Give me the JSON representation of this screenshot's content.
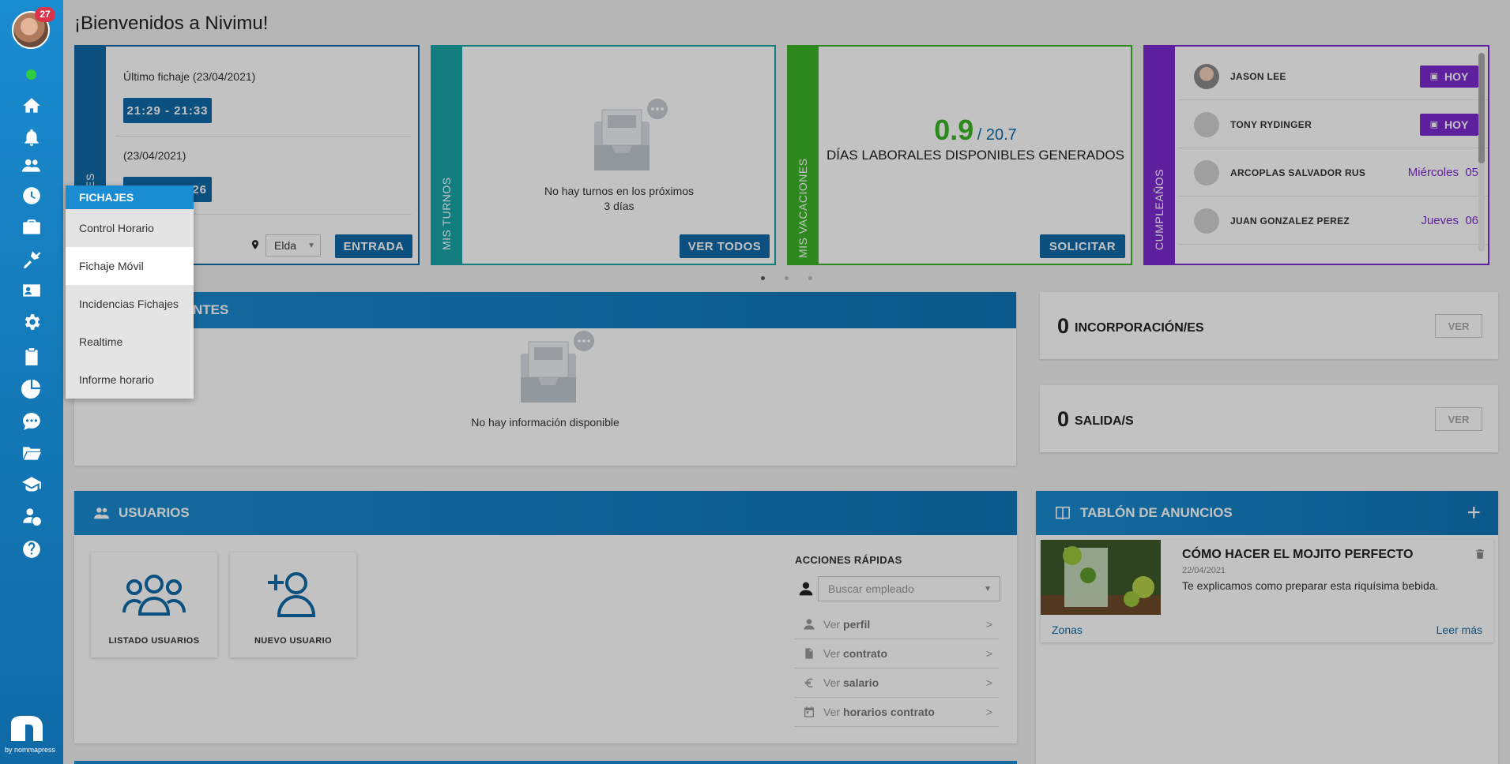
{
  "header": {
    "title": "¡Bienvenidos a Nivimu!"
  },
  "sidebar": {
    "badge": "27",
    "logo_text": "by nommapress",
    "icons": [
      "home-icon",
      "bell-icon",
      "users-icon",
      "clock-icon",
      "briefcase-icon",
      "tools-icon",
      "id-card-icon",
      "gear-icon",
      "clipboard-icon",
      "pie-chart-icon",
      "chat-icon",
      "folder-icon",
      "graduation-icon",
      "user-dollar-icon",
      "help-icon"
    ]
  },
  "fichajes_card": {
    "vertical_label": "ES",
    "last_label": "Último fichaje (23/04/2021)",
    "last_time": "21:29 - 21:33",
    "second_label": "(23/04/2021)",
    "second_time_suffix": "26",
    "location": "Elda",
    "button": "ENTRADA"
  },
  "turnos_card": {
    "vertical_label": "MIS TURNOS",
    "empty_line1": "No hay turnos en los próximos",
    "empty_line2": "3 días",
    "button": "VER TODOS"
  },
  "vacaciones_card": {
    "vertical_label": "MIS VACACIONES",
    "value": "0.9",
    "total": "/ 20.7",
    "caption": "DÍAS LABORALES DISPONIBLES GENERADOS",
    "button": "SOLICITAR"
  },
  "cumple_card": {
    "vertical_label": "CUMPLEAÑOS",
    "people": [
      {
        "name": "JASON LEE",
        "tag": "HOY"
      },
      {
        "name": "TONY RYDINGER",
        "tag": "HOY"
      },
      {
        "name": "ARCOPLAS SALVADOR RUS",
        "day": "Miércoles",
        "num": "05"
      },
      {
        "name": "JUAN GONZALEZ PEREZ",
        "day": "Jueves",
        "num": "06"
      }
    ]
  },
  "pendientes": {
    "title": "NTES",
    "empty": "No hay información disponible"
  },
  "incorporaciones": {
    "count": "0",
    "label": "INCORPORACIÓN/ES",
    "button": "VER"
  },
  "salidas": {
    "count": "0",
    "label": "SALIDA/S",
    "button": "VER"
  },
  "usuarios": {
    "title": "USUARIOS",
    "tile1": "LISTADO USUARIOS",
    "tile2": "NUEVO USUARIO",
    "quick_title": "ACCIONES RÁPIDAS",
    "search_placeholder": "Buscar empleado",
    "actions": [
      {
        "prefix": "Ver",
        "bold": "perfil"
      },
      {
        "prefix": "Ver",
        "bold": "contrato"
      },
      {
        "prefix": "Ver",
        "bold": "salario"
      },
      {
        "prefix": "Ver",
        "bold": "horarios contrato"
      }
    ]
  },
  "anuncios": {
    "title": "TABLÓN DE ANUNCIOS",
    "post_title": "CÓMO HACER EL MOJITO PERFECTO",
    "post_date": "22/04/2021",
    "post_text": "Te explicamos como preparar esta riquísima bebida.",
    "post_tag": "Zonas",
    "read_more": "Leer más"
  },
  "dropdown": {
    "title": "FICHAJES",
    "items": [
      "Control Horario",
      "Fichaje Móvil",
      "Incidencias Fichajes",
      "Realtime",
      "Informe horario"
    ]
  },
  "colors": {
    "blue": "#0f6aa6",
    "teal": "#1aa3a8",
    "green": "#3cb527",
    "purple": "#7d2bd0"
  }
}
